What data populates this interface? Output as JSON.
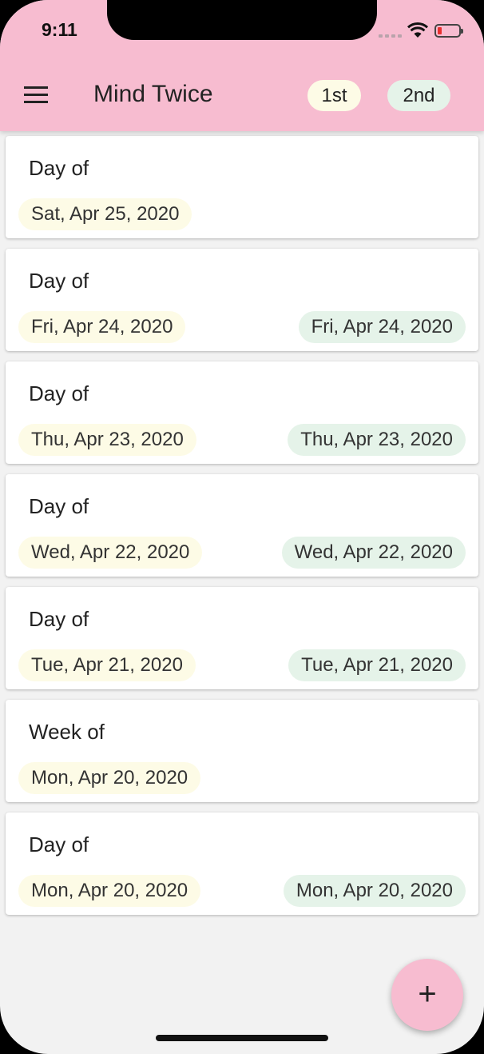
{
  "status_bar": {
    "time": "9:11",
    "battery_color": "#e8302f"
  },
  "app_bar": {
    "menu_icon": "hamburger-menu-icon",
    "title": "Mind Twice",
    "first_button": "1st",
    "second_button": "2nd",
    "background": "#f7bcd0",
    "first_color": "#fdfbe6",
    "second_color": "#e5f3e9"
  },
  "entries": [
    {
      "label": "Day of",
      "first": "Sat, Apr 25, 2020",
      "second": ""
    },
    {
      "label": "Day of",
      "first": "Fri, Apr 24, 2020",
      "second": "Fri, Apr 24, 2020"
    },
    {
      "label": "Day of",
      "first": "Thu, Apr 23, 2020",
      "second": "Thu, Apr 23, 2020"
    },
    {
      "label": "Day of",
      "first": "Wed, Apr 22, 2020",
      "second": "Wed, Apr 22, 2020"
    },
    {
      "label": "Day of",
      "first": "Tue, Apr 21, 2020",
      "second": "Tue, Apr 21, 2020"
    },
    {
      "label": "Week of",
      "first": "Mon, Apr 20, 2020",
      "second": ""
    },
    {
      "label": "Day of",
      "first": "Mon, Apr 20, 2020",
      "second": "Mon, Apr 20, 2020"
    }
  ],
  "fab": {
    "label": "+",
    "icon": "plus-icon"
  }
}
